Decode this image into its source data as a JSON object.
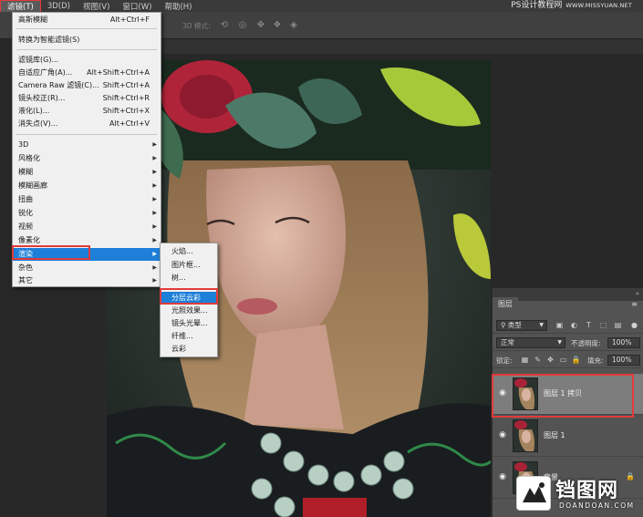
{
  "menubar": {
    "items": [
      "滤镜(T)",
      "3D(D)",
      "视图(V)",
      "窗口(W)",
      "帮助(H)"
    ],
    "watermark": "PS设计教程网",
    "watermark_url": "WWW.MISSYUAN.NET"
  },
  "options_bar": {
    "mode_label": "3D 模式："
  },
  "filter_menu": {
    "last_filter": {
      "label": "高斯模糊",
      "shortcut": "Alt+Ctrl+F"
    },
    "convert_smart": {
      "label": "转换为智能滤镜(S)"
    },
    "group2": [
      {
        "label": "滤镜库(G)...",
        "shortcut": ""
      },
      {
        "label": "自适应广角(A)...",
        "shortcut": "Alt+Shift+Ctrl+A"
      },
      {
        "label": "Camera Raw 滤镜(C)...",
        "shortcut": "Shift+Ctrl+A"
      },
      {
        "label": "镜头校正(R)...",
        "shortcut": "Shift+Ctrl+R"
      },
      {
        "label": "液化(L)...",
        "shortcut": "Shift+Ctrl+X"
      },
      {
        "label": "消失点(V)...",
        "shortcut": "Alt+Ctrl+V"
      }
    ],
    "group3": [
      "3D",
      "风格化",
      "模糊",
      "模糊画廊",
      "扭曲",
      "锐化",
      "视频",
      "像素化",
      "渲染",
      "杂色",
      "其它"
    ],
    "highlighted": "渲染"
  },
  "render_submenu": {
    "items": [
      "火焰...",
      "图片框...",
      "树...",
      "分层云彩",
      "光照效果...",
      "镜头光晕...",
      "纤维...",
      "云彩"
    ],
    "highlighted": "分层云彩"
  },
  "layers_panel": {
    "tab": "图层",
    "filter_kind": "类型",
    "blend_mode": "正常",
    "opacity_label": "不透明度:",
    "opacity_value": "100%",
    "lock_label": "锁定:",
    "fill_label": "填充:",
    "fill_value": "100%",
    "layers": [
      {
        "name": "图层 1 拷贝",
        "active": true
      },
      {
        "name": "图层 1",
        "active": false
      },
      {
        "name": "背景",
        "active": false,
        "locked": true
      }
    ]
  },
  "corner_watermark": {
    "text": "铛图网",
    "url": "DOANDOAN.COM"
  },
  "colors": {
    "highlight": "#1d7fd8",
    "annotation": "#e13b3b",
    "panel": "#535353"
  }
}
